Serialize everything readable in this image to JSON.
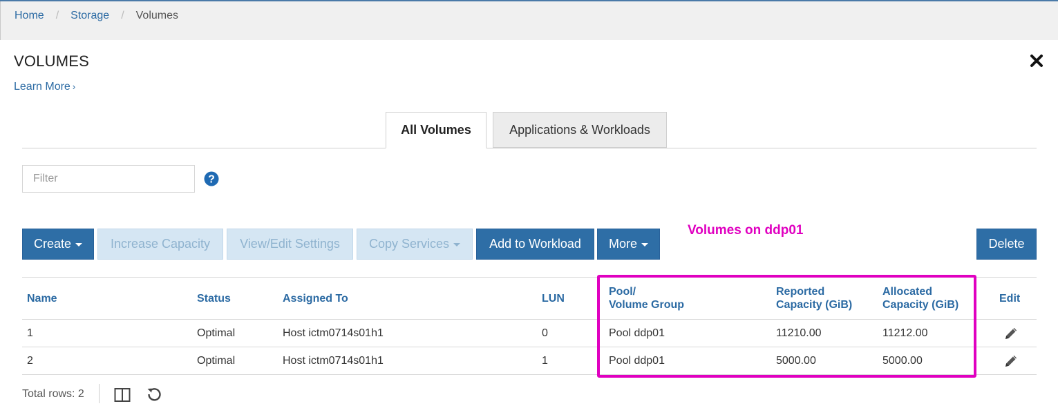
{
  "breadcrumb": {
    "items": [
      "Home",
      "Storage"
    ],
    "current": "Volumes"
  },
  "page": {
    "title": "VOLUMES",
    "learn_more": "Learn More"
  },
  "tabs": [
    {
      "label": "All Volumes"
    },
    {
      "label": "Applications & Workloads"
    }
  ],
  "filter": {
    "placeholder": "Filter",
    "value": ""
  },
  "toolbar": {
    "create": "Create",
    "increase_capacity": "Increase Capacity",
    "view_edit_settings": "View/Edit Settings",
    "copy_services": "Copy Services",
    "add_to_workload": "Add to Workload",
    "more": "More",
    "delete": "Delete"
  },
  "annotation": "Volumes on ddp01",
  "table": {
    "headers": {
      "name": "Name",
      "status": "Status",
      "assigned_to": "Assigned To",
      "lun": "LUN",
      "pool_line1": "Pool/",
      "pool_line2": "Volume Group",
      "reported_line1": "Reported",
      "reported_line2": "Capacity (GiB)",
      "allocated_line1": "Allocated",
      "allocated_line2": "Capacity (GiB)",
      "edit": "Edit"
    },
    "rows": [
      {
        "name": "1",
        "status": "Optimal",
        "assigned_to": "Host ictm0714s01h1",
        "lun": "0",
        "pool": "Pool ddp01",
        "reported": "11210.00",
        "allocated": "11212.00"
      },
      {
        "name": "2",
        "status": "Optimal",
        "assigned_to": "Host ictm0714s01h1",
        "lun": "1",
        "pool": "Pool ddp01",
        "reported": "5000.00",
        "allocated": "5000.00"
      }
    ]
  },
  "footer": {
    "total_rows": "Total rows: 2"
  },
  "colors": {
    "primary": "#2e6ea6",
    "link": "#2b6aa3",
    "annotation": "#e000c0",
    "disabled_bg": "#d5e6f3"
  },
  "icons": [
    "close-icon",
    "chevron-right-icon",
    "help-icon",
    "caret-down-icon",
    "pencil-icon",
    "columns-icon",
    "refresh-icon"
  ]
}
